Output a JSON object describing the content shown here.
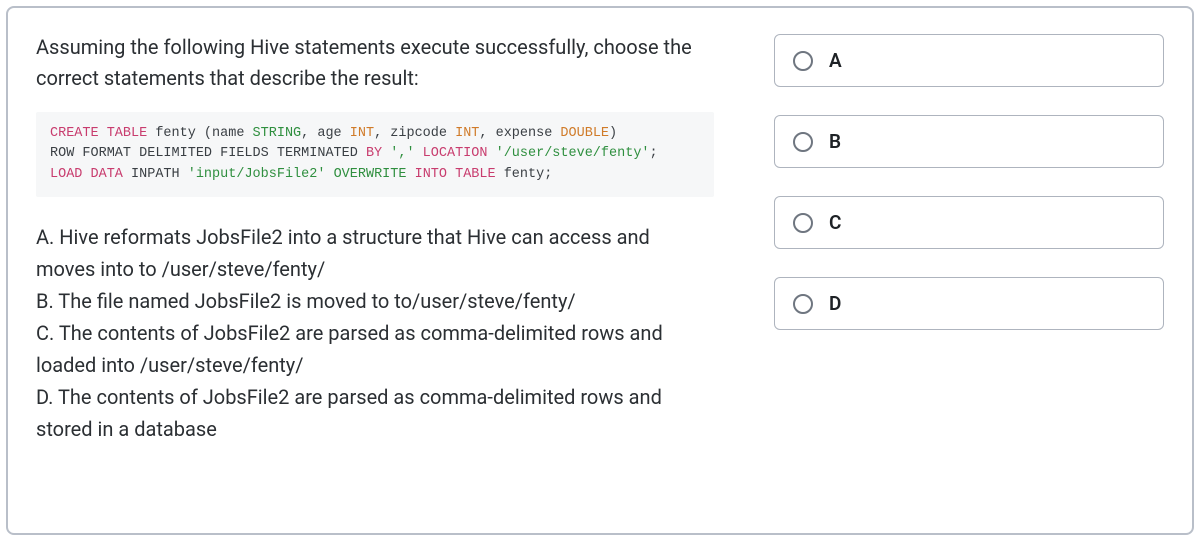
{
  "question": {
    "prompt": "Assuming the following Hive statements execute successfully, choose the correct statements that describe the result:",
    "code": {
      "line1": {
        "t1": "CREATE TABLE",
        "t2": " fenty (name ",
        "t3": "STRING",
        "t4": ", age ",
        "t5": "INT",
        "t6": ", zipcode ",
        "t7": "INT",
        "t8": ", expense ",
        "t9": "DOUBLE",
        "t10": ")"
      },
      "line2": {
        "t1": "ROW FORMAT DELIMITED FIELDS TERMINATED ",
        "t2": "BY ",
        "t3": "','",
        "t4": " LOCATION ",
        "t5": "'/user/steve/fenty'",
        "t6": ";"
      },
      "line3": {
        "t1": "LOAD DATA ",
        "t2": "INPATH ",
        "t3": "'input/JobsFile2'",
        "t4": " OVERWRITE ",
        "t5": "INTO TABLE",
        "t6": " fenty;"
      }
    },
    "answers": {
      "a": "A. Hive reformats JobsFile2 into a structure that Hive can access and moves into to /user/steve/fenty/",
      "b": "B. The file named JobsFile2 is moved to to/user/steve/fenty/",
      "c": "C. The contents of JobsFile2 are parsed as comma-delimited rows and loaded into /user/steve/fenty/",
      "d": "D. The contents of JobsFile2 are parsed as comma-delimited rows and stored in a database"
    }
  },
  "options": {
    "a": "A",
    "b": "B",
    "c": "C",
    "d": "D"
  }
}
